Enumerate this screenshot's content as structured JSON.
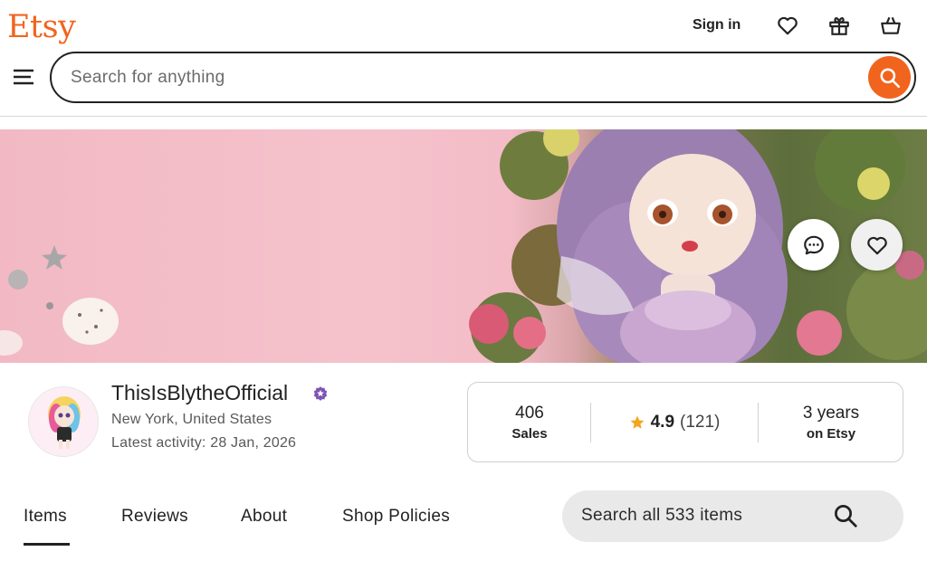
{
  "header": {
    "logo": "Etsy",
    "sign_in": "Sign in",
    "icons": [
      "heart-icon",
      "gift-icon",
      "basket-icon",
      "menu-icon",
      "search-icon"
    ],
    "search_placeholder": "Search for anything",
    "accent_color": "#f1641e"
  },
  "banner": {
    "message_icon": "message-icon",
    "favorite_icon": "heart-icon"
  },
  "shop": {
    "name": "ThisIsBlytheOfficial",
    "badge_icon": "star-seller-badge-icon",
    "location": "New York, United States",
    "activity": "Latest activity: 28 Jan, 2026",
    "stats": {
      "sales_value": "406",
      "sales_label": "Sales",
      "rating": "4.9",
      "rating_count": "(121)",
      "years_value": "3 years",
      "years_label": "on Etsy"
    }
  },
  "tabs": {
    "items": "Items",
    "reviews": "Reviews",
    "about": "About",
    "policies": "Shop Policies",
    "active": "Items"
  },
  "shop_search": {
    "placeholder": "Search all 533 items"
  }
}
